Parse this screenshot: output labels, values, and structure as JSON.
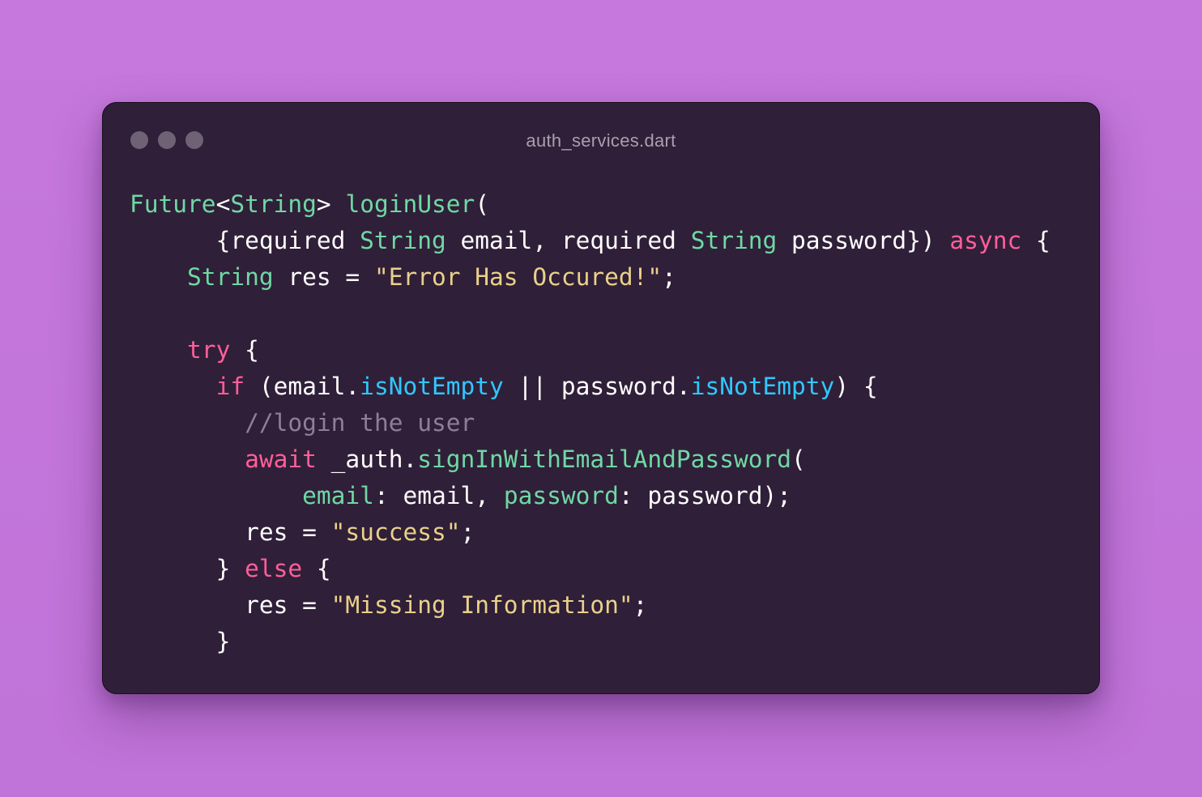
{
  "window": {
    "title": "auth_services.dart",
    "dots": [
      "close",
      "minimize",
      "maximize"
    ]
  },
  "code": {
    "lines": [
      [
        {
          "t": "Future",
          "c": "type"
        },
        {
          "t": "<",
          "c": "plain"
        },
        {
          "t": "String",
          "c": "type"
        },
        {
          "t": "> ",
          "c": "plain"
        },
        {
          "t": "loginUser",
          "c": "fn"
        },
        {
          "t": "(",
          "c": "plain"
        }
      ],
      [
        {
          "t": "      {required ",
          "c": "plain"
        },
        {
          "t": "String",
          "c": "type"
        },
        {
          "t": " email, required ",
          "c": "plain"
        },
        {
          "t": "String",
          "c": "type"
        },
        {
          "t": " password}) ",
          "c": "plain"
        },
        {
          "t": "async",
          "c": "kw"
        },
        {
          "t": " {",
          "c": "plain"
        }
      ],
      [
        {
          "t": "    ",
          "c": "plain"
        },
        {
          "t": "String",
          "c": "type"
        },
        {
          "t": " res = ",
          "c": "plain"
        },
        {
          "t": "\"Error Has Occured!\"",
          "c": "str"
        },
        {
          "t": ";",
          "c": "plain"
        }
      ],
      [],
      [
        {
          "t": "    ",
          "c": "plain"
        },
        {
          "t": "try",
          "c": "kw"
        },
        {
          "t": " {",
          "c": "plain"
        }
      ],
      [
        {
          "t": "      ",
          "c": "plain"
        },
        {
          "t": "if",
          "c": "kw"
        },
        {
          "t": " (email.",
          "c": "plain"
        },
        {
          "t": "isNotEmpty",
          "c": "meth"
        },
        {
          "t": " || password.",
          "c": "plain"
        },
        {
          "t": "isNotEmpty",
          "c": "meth"
        },
        {
          "t": ") {",
          "c": "plain"
        }
      ],
      [
        {
          "t": "        ",
          "c": "plain"
        },
        {
          "t": "//login the user",
          "c": "cmt"
        }
      ],
      [
        {
          "t": "        ",
          "c": "plain"
        },
        {
          "t": "await",
          "c": "kw"
        },
        {
          "t": " _auth.",
          "c": "plain"
        },
        {
          "t": "signInWithEmailAndPassword",
          "c": "fn"
        },
        {
          "t": "(",
          "c": "plain"
        }
      ],
      [
        {
          "t": "            ",
          "c": "plain"
        },
        {
          "t": "email",
          "c": "fn"
        },
        {
          "t": ": email, ",
          "c": "plain"
        },
        {
          "t": "password",
          "c": "fn"
        },
        {
          "t": ": password);",
          "c": "plain"
        }
      ],
      [
        {
          "t": "        res = ",
          "c": "plain"
        },
        {
          "t": "\"success\"",
          "c": "str"
        },
        {
          "t": ";",
          "c": "plain"
        }
      ],
      [
        {
          "t": "      } ",
          "c": "plain"
        },
        {
          "t": "else",
          "c": "kw"
        },
        {
          "t": " {",
          "c": "plain"
        }
      ],
      [
        {
          "t": "        res = ",
          "c": "plain"
        },
        {
          "t": "\"Missing Information\"",
          "c": "str"
        },
        {
          "t": ";",
          "c": "plain"
        }
      ],
      [
        {
          "t": "      }",
          "c": "plain"
        }
      ]
    ]
  },
  "colors": {
    "background": "#c678dc",
    "window": "#301f38",
    "type": "#6fd8a4",
    "keyword": "#ff5f9a",
    "string": "#ead18a",
    "method": "#2fc8ff",
    "comment": "#8e7f98",
    "plain": "#ffffff"
  }
}
